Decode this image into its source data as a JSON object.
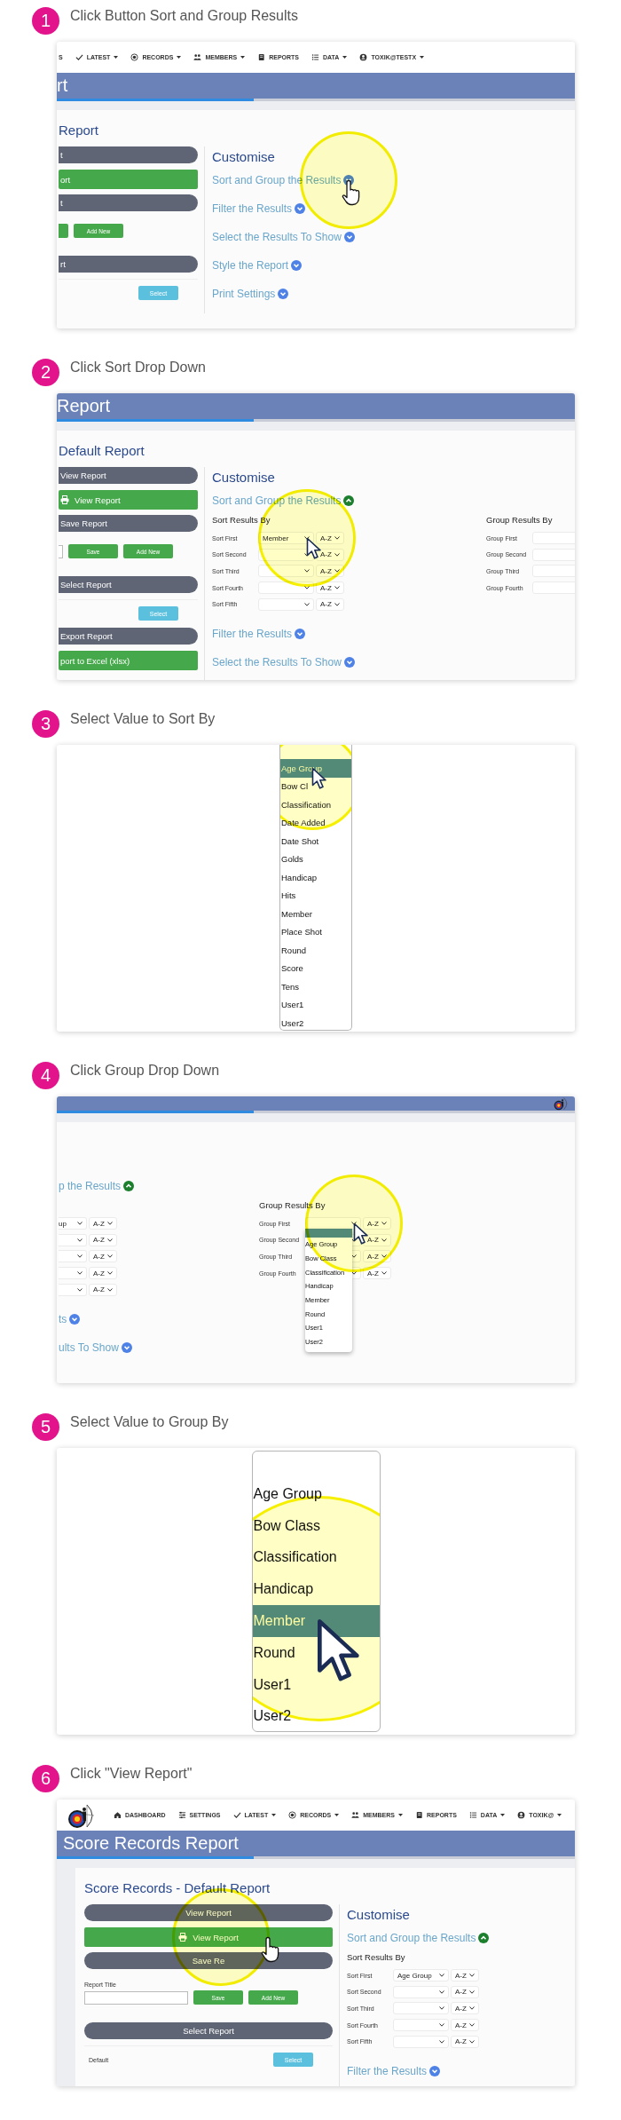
{
  "steps": [
    {
      "number": "1",
      "title": "Click Button Sort and Group Results",
      "shot": {
        "kind": "cropped-app",
        "nav": {
          "items": [
            {
              "kind": "clipped",
              "label": "S"
            },
            {
              "kind": "latest",
              "label": "LATEST"
            },
            {
              "kind": "records",
              "label": "RECORDS"
            },
            {
              "kind": "members",
              "label": "MEMBERS"
            },
            {
              "kind": "reports",
              "label": "REPORTS"
            },
            {
              "kind": "data",
              "label": "DATA"
            },
            {
              "kind": "account",
              "label": "TOXIK@TESTX"
            }
          ]
        },
        "banner": {
          "title": "rt"
        },
        "heading": "Report",
        "left": [
          {
            "kind": "dark",
            "label": "t"
          },
          {
            "kind": "green",
            "label": "ort"
          },
          {
            "kind": "dark",
            "label": "t"
          },
          {
            "kind": "form",
            "buttons": [
              {
                "kind": "clipped"
              },
              {
                "kind": "full",
                "label": "Add New"
              }
            ]
          },
          {
            "kind": "dark",
            "label": "rt"
          },
          {
            "kind": "select",
            "button": "Select"
          }
        ],
        "customise": {
          "title": "Customise",
          "sections": [
            {
              "label": "Sort and Group the Results",
              "expanded": false,
              "cursor": {
                "kind": "hand"
              }
            },
            {
              "label": "Filter the Results",
              "expanded": false
            },
            {
              "label": "Select the Results To Show",
              "expanded": false
            },
            {
              "label": "Style the Report",
              "expanded": false
            },
            {
              "label": "Print Settings",
              "expanded": false
            }
          ]
        }
      }
    },
    {
      "number": "2",
      "title": "Click Sort Drop Down",
      "shot": {
        "kind": "cropped-app",
        "banner": {
          "title": "Report"
        },
        "heading": "Default Report",
        "left": [
          {
            "kind": "dark",
            "label": "View Report"
          },
          {
            "kind": "print",
            "label": "View Report"
          },
          {
            "kind": "dark",
            "label": "Save Report"
          },
          {
            "kind": "form",
            "field": {
              "kind": "clipped"
            },
            "buttons": [
              {
                "kind": "full",
                "label": "Save"
              },
              {
                "kind": "full",
                "label": "Add New"
              }
            ]
          },
          {
            "kind": "dark",
            "label": "Select Report"
          },
          {
            "kind": "select",
            "button": "Select"
          },
          {
            "kind": "dark",
            "label": "Export Report"
          },
          {
            "kind": "green",
            "label": "port to Excel (xlsx)"
          }
        ],
        "customise": {
          "title": "Customise",
          "sections": [
            {
              "label": "Sort and Group the Results",
              "expanded": true,
              "sort": {
                "title": "Sort Results By",
                "rows": [
                  {
                    "label": "Sort First",
                    "value": "Member",
                    "order": "A-Z",
                    "cursor": {
                      "kind": "arrow"
                    }
                  },
                  {
                    "label": "Sort Second",
                    "order": "A-Z"
                  },
                  {
                    "label": "Sort Third",
                    "order": "A-Z"
                  },
                  {
                    "label": "Sort Fourth",
                    "order": "A-Z"
                  },
                  {
                    "label": "Sort Fifth",
                    "order": "A-Z"
                  }
                ]
              },
              "group": {
                "title": "Group Results By",
                "rows": [
                  {
                    "label": "Group First"
                  },
                  {
                    "label": "Group Second"
                  },
                  {
                    "label": "Group Third"
                  },
                  {
                    "label": "Group Fourth"
                  }
                ]
              }
            },
            {
              "label": "Filter the Results",
              "expanded": false
            },
            {
              "label": "Select the Results To Show",
              "expanded": false
            }
          ]
        }
      }
    },
    {
      "number": "3",
      "title": "Select Value to Sort By",
      "shot": {
        "kind": "dropdown-list",
        "items": [
          {
            "label": "Age Group",
            "selected": true,
            "cursor": {
              "kind": "arrow"
            }
          },
          {
            "label": "Bow Cl",
            "selected": false
          },
          {
            "label": "Classification",
            "selected": false
          },
          {
            "label": "Date Added",
            "selected": false
          },
          {
            "label": "Date Shot",
            "selected": false
          },
          {
            "label": "Golds",
            "selected": false
          },
          {
            "label": "Handicap",
            "selected": false
          },
          {
            "label": "Hits",
            "selected": false
          },
          {
            "label": "Member",
            "selected": false
          },
          {
            "label": "Place Shot",
            "selected": false
          },
          {
            "label": "Round",
            "selected": false
          },
          {
            "label": "Score",
            "selected": false
          },
          {
            "label": "Tens",
            "selected": false
          },
          {
            "label": "User1",
            "selected": false
          },
          {
            "label": "User2",
            "selected": false
          }
        ]
      }
    },
    {
      "number": "4",
      "title": "Click Group Drop Down",
      "shot": {
        "kind": "cropped-app",
        "banner": {
          "logo": true
        },
        "customise": {
          "sections": [
            {
              "label": "p the Results",
              "expanded": true,
              "sort": {
                "rows": [
                  {
                    "value": "up",
                    "order": "A-Z"
                  },
                  {
                    "order": "A-Z"
                  },
                  {
                    "order": "A-Z"
                  },
                  {
                    "order": "A-Z"
                  },
                  {
                    "order": "A-Z"
                  }
                ]
              },
              "group": {
                "title": "Group Results By",
                "rows": [
                  {
                    "label": "Group First",
                    "order": "A-Z",
                    "cursor": {
                      "kind": "arrow"
                    },
                    "options": [
                      {
                        "selected": true
                      },
                      {
                        "label": "Age Group",
                        "selected": false
                      },
                      {
                        "label": "Bow Class",
                        "selected": false
                      },
                      {
                        "label": "Classification",
                        "selected": false
                      },
                      {
                        "label": "Handicap",
                        "selected": false
                      },
                      {
                        "label": "Member",
                        "selected": false
                      },
                      {
                        "label": "Round",
                        "selected": false
                      },
                      {
                        "label": "User1",
                        "selected": false
                      },
                      {
                        "label": "User2",
                        "selected": false
                      }
                    ]
                  },
                  {
                    "label": "Group Second",
                    "order": "A-Z"
                  },
                  {
                    "label": "Group Third",
                    "order": "A-Z"
                  },
                  {
                    "label": "Group Fourth",
                    "order": "A-Z"
                  }
                ]
              }
            },
            {
              "label": "ts",
              "expanded": false
            },
            {
              "label": "ults To Show",
              "expanded": false
            }
          ]
        }
      }
    },
    {
      "number": "5",
      "title": "Select Value to Group By",
      "shot": {
        "kind": "zoom-list",
        "items": [
          {
            "label": "Age Group",
            "selected": false
          },
          {
            "label": "Bow Class",
            "selected": false
          },
          {
            "label": "Classification",
            "selected": false
          },
          {
            "label": "Handicap",
            "selected": false
          },
          {
            "label": "Member",
            "selected": true,
            "cursor": {
              "kind": "arrow"
            }
          },
          {
            "label": "Round",
            "selected": false
          },
          {
            "label": "User1",
            "selected": false
          },
          {
            "label": "User2",
            "selected": false
          }
        ]
      }
    },
    {
      "number": "6",
      "title": "Click \"View Report\"",
      "shot": {
        "kind": "app",
        "nav": {
          "logo": true,
          "items": [
            {
              "kind": "dashboard",
              "label": "DASHBOARD"
            },
            {
              "kind": "settings",
              "label": "SETTINGS"
            },
            {
              "kind": "latest",
              "label": "LATEST"
            },
            {
              "kind": "records",
              "label": "RECORDS"
            },
            {
              "kind": "members",
              "label": "MEMBERS"
            },
            {
              "kind": "reports",
              "label": "REPORTS"
            },
            {
              "kind": "data",
              "label": "DATA"
            },
            {
              "kind": "account",
              "label": "TOXIK@"
            }
          ]
        },
        "banner": {
          "title": "Score Records Report"
        },
        "heading": "Score Records - Default Report",
        "left": [
          {
            "kind": "dark",
            "label": "View Report"
          },
          {
            "kind": "print",
            "label": "View Report",
            "cursor": {
              "kind": "hand"
            }
          },
          {
            "kind": "dark",
            "label": "Save Re"
          },
          {
            "kind": "form",
            "label": "Report Title",
            "field": {
              "kind": "full"
            },
            "buttons": [
              {
                "kind": "full",
                "label": "Save"
              },
              {
                "kind": "full",
                "label": "Add New"
              }
            ]
          },
          {
            "kind": "dark",
            "label": "Select Report"
          },
          {
            "kind": "select",
            "label": "Default",
            "button": "Select"
          }
        ],
        "customise": {
          "title": "Customise",
          "sections": [
            {
              "label": "Sort and Group the Results",
              "expanded": true,
              "sort": {
                "title": "Sort Results By",
                "rows": [
                  {
                    "label": "Sort First",
                    "value": "Age Group",
                    "order": "A-Z"
                  },
                  {
                    "label": "Sort Second",
                    "order": "A-Z"
                  },
                  {
                    "label": "Sort Third",
                    "order": "A-Z"
                  },
                  {
                    "label": "Sort Fourth",
                    "order": "A-Z"
                  },
                  {
                    "label": "Sort Fifth",
                    "order": "A-Z"
                  }
                ]
              }
            },
            {
              "label": "Filter the Results",
              "expanded": false
            }
          ]
        }
      }
    }
  ]
}
